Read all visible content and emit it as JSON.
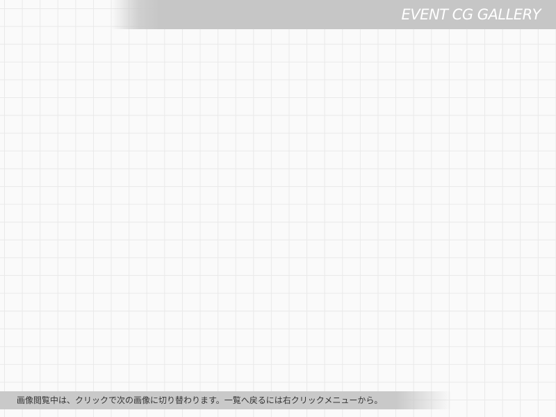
{
  "header": {
    "title": "EVENT CG GALLERY"
  },
  "footer": {
    "hint": "画像閲覧中は、クリックで次の画像に切り替わります。一覧へ戻るには右クリックメニューから。"
  }
}
